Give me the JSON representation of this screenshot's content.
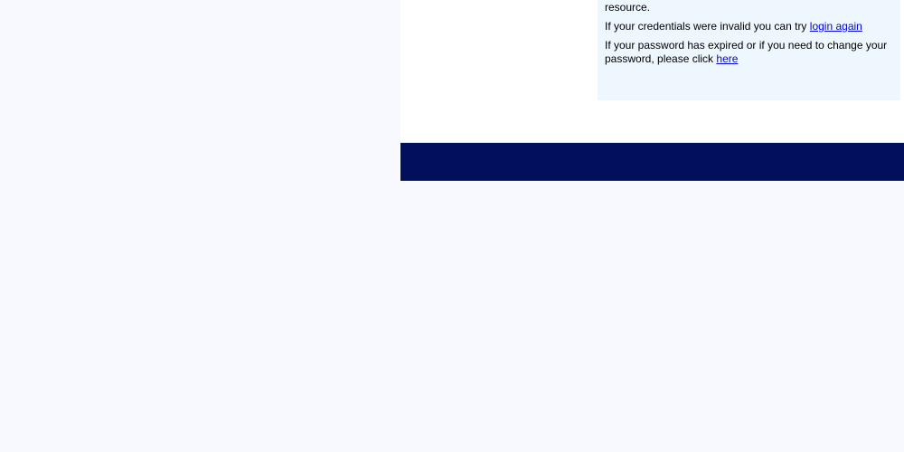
{
  "messages": {
    "assistance_text": "Administration if you need assistance to access this resource.",
    "invalid_prefix": "If your credentials were invalid you can try ",
    "login_again_link": "login again",
    "expired_prefix": "If your password has expired or if you need to change your password, please click ",
    "here_link": "here"
  },
  "colors": {
    "page_background": "#f7f9fe",
    "panel_background": "#eef6fe",
    "footer_bar": "#00105a",
    "link": "#0000ee"
  }
}
